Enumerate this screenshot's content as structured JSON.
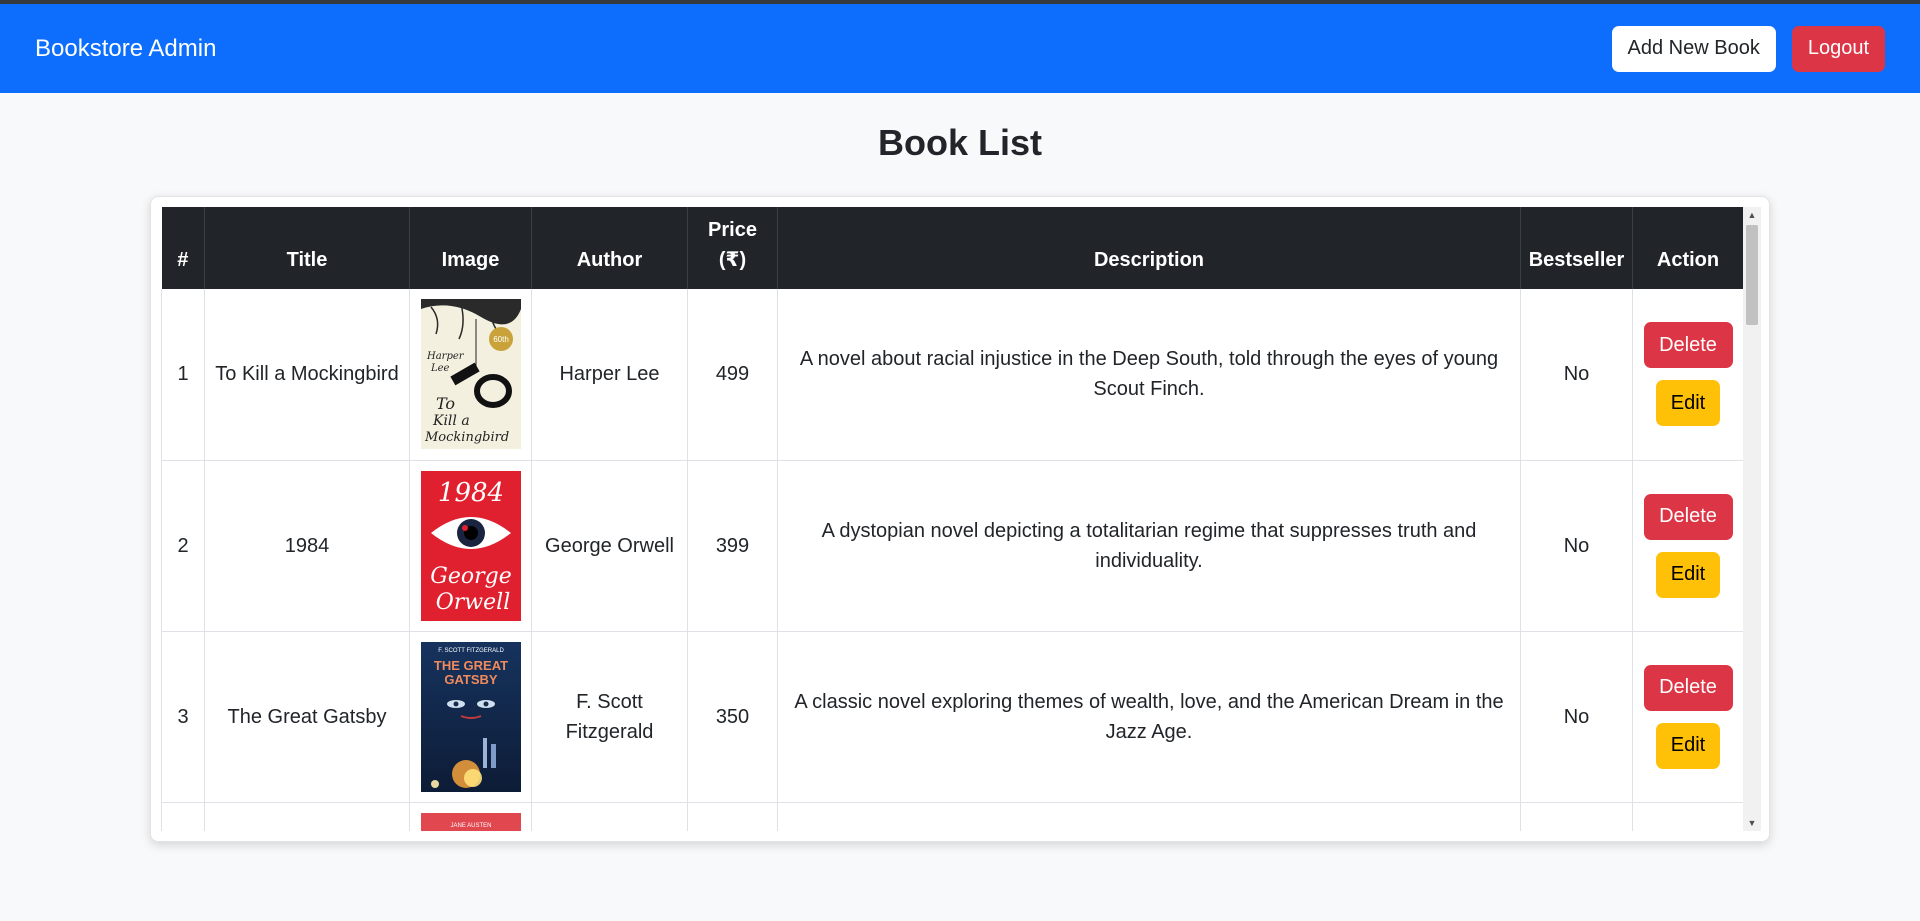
{
  "navbar": {
    "brand": "Bookstore Admin",
    "add_button": "Add New Book",
    "logout_button": "Logout"
  },
  "page": {
    "title": "Book List"
  },
  "table": {
    "headers": {
      "num": "#",
      "title": "Title",
      "image": "Image",
      "author": "Author",
      "price_line1": "Price",
      "price_line2": "(₹)",
      "description": "Description",
      "bestseller": "Bestseller",
      "action": "Action"
    },
    "rows": [
      {
        "num": "1",
        "title": "To Kill a Mockingbird",
        "author": "Harper Lee",
        "price": "499",
        "description": "A novel about racial injustice in the Deep South, told through the eyes of young Scout Finch.",
        "bestseller": "No",
        "delete_label": "Delete",
        "edit_label": "Edit",
        "cover": {
          "line1": "Harper",
          "line2": "Lee",
          "line3": "To",
          "line4": "Kill a",
          "line5": "Mockingbird",
          "badge": "60th"
        }
      },
      {
        "num": "2",
        "title": "1984",
        "author": "George Orwell",
        "price": "399",
        "description": "A dystopian novel depicting a totalitarian regime that suppresses truth and individuality.",
        "bestseller": "No",
        "delete_label": "Delete",
        "edit_label": "Edit",
        "cover": {
          "line1": "1984",
          "line2": "George",
          "line3": "Orwell"
        }
      },
      {
        "num": "3",
        "title": "The Great Gatsby",
        "author": "F. Scott Fitzgerald",
        "price": "350",
        "description": "A classic novel exploring themes of wealth, love, and the American Dream in the Jazz Age.",
        "bestseller": "No",
        "delete_label": "Delete",
        "edit_label": "Edit",
        "cover": {
          "line1": "F. SCOTT FITZGERALD",
          "line2": "THE GREAT",
          "line3": "GATSBY"
        }
      }
    ],
    "partial_row": {
      "cover_text": "JANE AUSTEN"
    }
  },
  "colors": {
    "navbar": "#0d6efd",
    "danger": "#dc3545",
    "warning": "#ffc107",
    "table_header": "#212529"
  }
}
